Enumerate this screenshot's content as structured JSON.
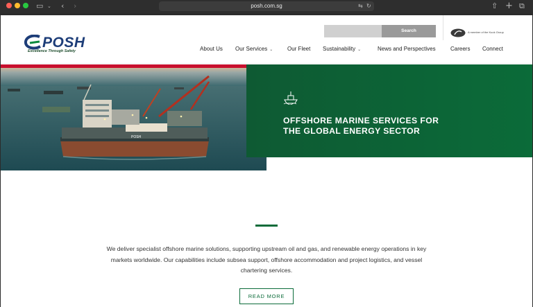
{
  "browser": {
    "url": "posh.com.sg",
    "icons": {
      "sidebar": "sidebar-icon",
      "back": "back-icon",
      "forward": "forward-icon",
      "translate": "translate-icon",
      "reload": "reload-icon",
      "share": "share-icon",
      "new_tab": "new-tab-icon",
      "tabs": "tabs-overview-icon"
    }
  },
  "header": {
    "logo_text": "POSH",
    "logo_tagline": "Excellence Through Safety",
    "search_placeholder": "",
    "search_button": "Search",
    "group_text": "A member of the Kuok Group",
    "nav": [
      {
        "label": "About Us",
        "dropdown": false
      },
      {
        "label": "Our Services",
        "dropdown": true
      },
      {
        "label": "Our Fleet",
        "dropdown": false
      },
      {
        "label": "Sustainability",
        "dropdown": true
      },
      {
        "label": "News and Perspectives",
        "dropdown": false
      },
      {
        "label": "Careers",
        "dropdown": false
      },
      {
        "label": "Connect",
        "dropdown": false
      }
    ]
  },
  "hero": {
    "icon": "ship-icon",
    "title_line1": "OFFSHORE MARINE SERVICES FOR",
    "title_line2": "THE GLOBAL ENERGY SECTOR",
    "vessel_label": "POSH"
  },
  "intro": {
    "text": "We deliver specialist offshore marine solutions, supporting upstream oil and gas, and renewable energy operations in key markets worldwide. Our capabilities include subsea support, offshore accommodation and project logistics, and vessel chartering services.",
    "button": "READ MORE"
  },
  "colors": {
    "brand_green": "#0b6b39",
    "brand_red": "#c8102e",
    "brand_blue": "#1d3d78"
  }
}
